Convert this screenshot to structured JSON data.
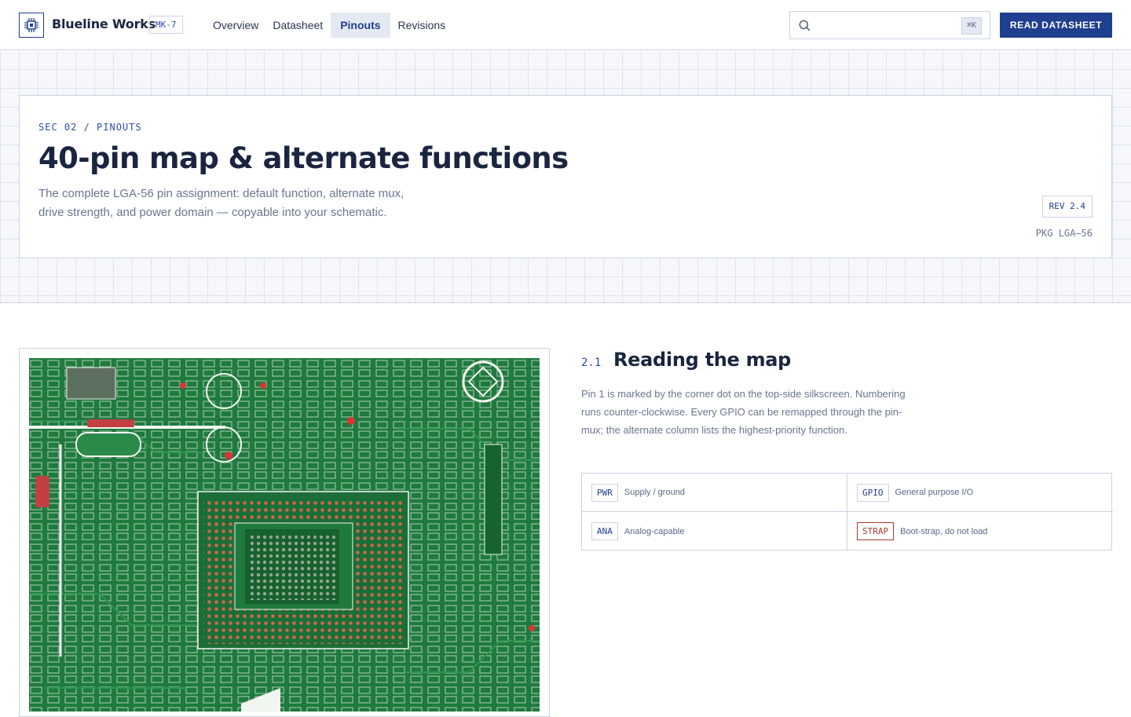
{
  "header": {
    "brand": "Blueline Works",
    "model": "MK-7",
    "nav": [
      {
        "label": "Overview",
        "active": false
      },
      {
        "label": "Datasheet",
        "active": false
      },
      {
        "label": "Pinouts",
        "active": true
      },
      {
        "label": "Revisions",
        "active": false
      }
    ],
    "search": {
      "placeholder": "",
      "shortcut": "⌘K"
    },
    "cta_label": "READ DATASHEET"
  },
  "hero": {
    "eyebrow": "SEC 02 / PINOUTS",
    "title": "40-pin map & alternate functions",
    "lede": "The complete LGA-56 pin assignment: default function, alternate mux, drive strength, and power domain — copyable into your schematic.",
    "rev": "REV 2.4",
    "package": "PKG LGA–56"
  },
  "figure": {
    "image_alt": "Photo of a green printed circuit board with a central LGA footprint"
  },
  "section": {
    "number": "2.1",
    "title": "Reading the map",
    "body": "Pin 1 is marked by the corner dot on the top-side silkscreen. Numbering runs counter-clockwise. Every GPIO can be remapped through the pin-mux; the alternate column lists the highest-priority function.",
    "legend": [
      {
        "tag": "PWR",
        "text": "Supply / ground",
        "warn": false
      },
      {
        "tag": "GPIO",
        "text": "General purpose I/O",
        "warn": false
      },
      {
        "tag": "ANA",
        "text": "Analog-capable",
        "warn": false
      },
      {
        "tag": "STRAP",
        "text": "Boot-strap, do not load",
        "warn": true
      }
    ]
  },
  "colors": {
    "accent": "#1f3f8f",
    "ink": "#1a2540",
    "muted": "#6a7590",
    "grid": "#dde3ee",
    "warn": "#a63a2d",
    "pcb_green": "#1f7a3e"
  },
  "icons": {
    "logo": "chip-icon",
    "search": "search-icon"
  }
}
